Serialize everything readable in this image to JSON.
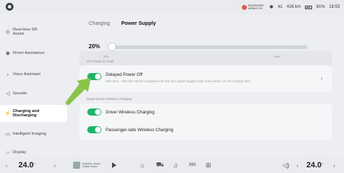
{
  "status_bar": {
    "airbag_text": "PASSENGER AIRBAG ON",
    "signal": "4G",
    "range": "416 km",
    "battery": "81%",
    "time": "18:53"
  },
  "sidebar": {
    "items": [
      {
        "label": "Real-time SR Assist",
        "icon": "steering-icon"
      },
      {
        "label": "Driver Assistance",
        "icon": "driver-icon"
      },
      {
        "label": "Voice Assistant",
        "icon": "voice-icon"
      },
      {
        "label": "Sounds",
        "icon": "speaker-icon"
      },
      {
        "label": "Charging and Discharging",
        "icon": "charging-icon"
      },
      {
        "label": "Intelligent Imaging",
        "icon": "camera-icon"
      },
      {
        "label": "Display",
        "icon": "sun-icon"
      }
    ]
  },
  "main": {
    "tabs": [
      {
        "label": "Charging"
      },
      {
        "label": "Power Supply"
      }
    ],
    "slider": {
      "value_label": "20%",
      "value_fraction": 0.0,
      "min_label": "20%",
      "max_label": "100%"
    },
    "section_trunk": "12V Power in Trunk",
    "delayed": {
      "title": "Delayed Power Off",
      "desc": "One-time - After the vehicle is powered off, the 12V power supply in the trunk will be cut off 1 hour(s) later.",
      "on": true
    },
    "section_wireless": "Smart Device Wireless Charging",
    "driver_wireless": {
      "title": "Driver Wireless Charging",
      "on": true
    },
    "passenger_wireless": {
      "title": "Passenger-side Wireless Charging",
      "on": true
    }
  },
  "bottom_bar": {
    "left_temp": "24.0",
    "right_temp": "24.0",
    "media_title": "Anytime, Anyw...",
    "media_artist": "Diable Hicks"
  },
  "colors": {
    "toggle_on": "#1db46a",
    "annotation_arrow": "#8bc34a"
  }
}
